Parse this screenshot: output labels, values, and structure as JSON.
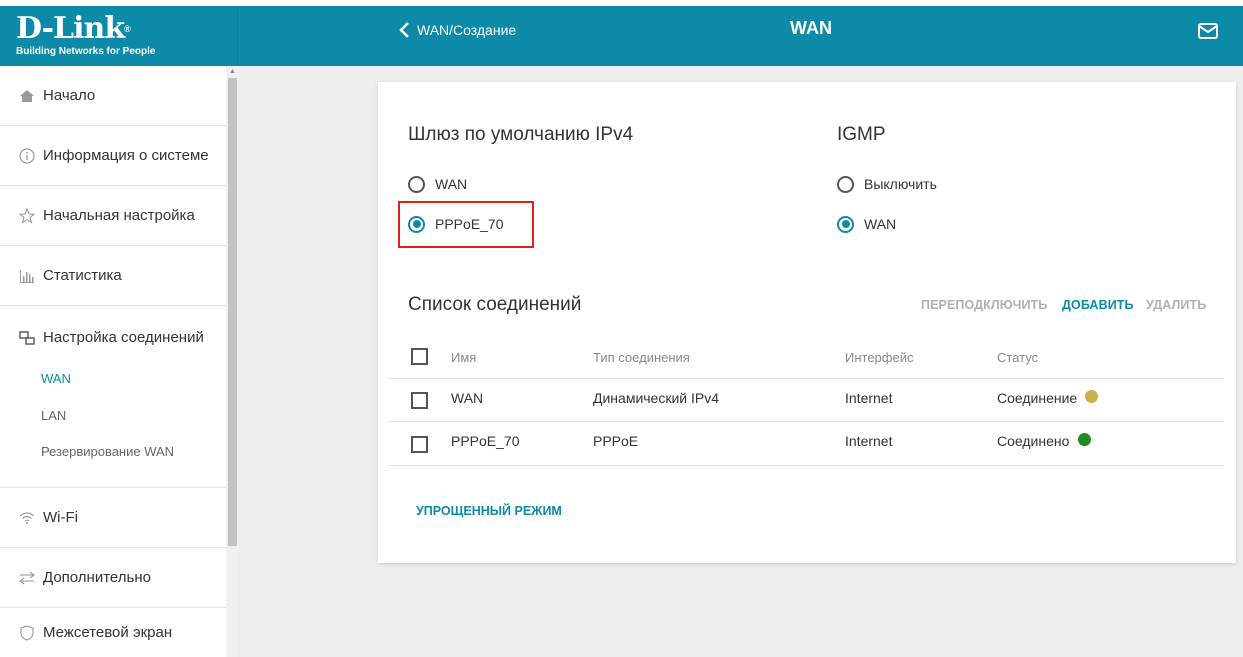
{
  "header": {
    "logo_main": "D-Link",
    "logo_subtitle": "Building Networks for People",
    "back_label": "WAN/Создание",
    "page_title": "WAN",
    "mail_icon": "envelope-icon",
    "bg_color": "#0c8aa8"
  },
  "sidebar": {
    "items": [
      {
        "label": "Начало",
        "icon": "home-icon"
      },
      {
        "label": "Информация о системе",
        "icon": "info-icon"
      },
      {
        "label": "Начальная настройка",
        "icon": "star-icon"
      },
      {
        "label": "Статистика",
        "icon": "bar-chart-icon"
      },
      {
        "label": "Настройка соединений",
        "icon": "network-icon"
      },
      {
        "label": "Wi-Fi",
        "icon": "wifi-icon"
      },
      {
        "label": "Дополнительно",
        "icon": "arrows-icon"
      },
      {
        "label": "Межсетевой экран",
        "icon": "shield-icon"
      }
    ],
    "subitems": [
      {
        "label": "WAN",
        "active": true
      },
      {
        "label": "LAN",
        "active": false
      },
      {
        "label": "Резервирование WAN",
        "active": false
      }
    ]
  },
  "gateway": {
    "title": "Шлюз по умолчанию IPv4",
    "options": [
      {
        "label": "WAN",
        "checked": false
      },
      {
        "label": "PPPoE_70",
        "checked": true
      }
    ]
  },
  "igmp": {
    "title": "IGMP",
    "options": [
      {
        "label": "Выключить",
        "checked": false
      },
      {
        "label": "WAN",
        "checked": true
      }
    ]
  },
  "connections": {
    "title": "Список соединений",
    "actions": {
      "reconnect": "ПЕРЕПОДКЛЮЧИТЬ",
      "add": "ДОБАВИТЬ",
      "delete": "УДАЛИТЬ"
    },
    "columns": [
      "Имя",
      "Тип соединения",
      "Интерфейс",
      "Статус"
    ],
    "rows": [
      {
        "name": "WAN",
        "type": "Динамический IPv4",
        "iface": "Internet",
        "status": "Соединение",
        "status_color": "#c9b24a"
      },
      {
        "name": "PPPoE_70",
        "type": "PPPoE",
        "iface": "Internet",
        "status": "Соединено",
        "status_color": "#1e8c1e"
      }
    ]
  },
  "simple_mode_label": "УПРОЩЕННЫЙ РЕЖИМ"
}
